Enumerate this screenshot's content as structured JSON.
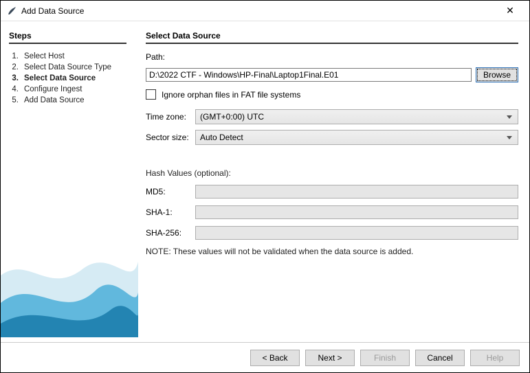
{
  "window": {
    "title": "Add Data Source"
  },
  "sidebar": {
    "heading": "Steps",
    "steps": [
      {
        "num": "1.",
        "label": "Select Host"
      },
      {
        "num": "2.",
        "label": "Select Data Source Type"
      },
      {
        "num": "3.",
        "label": "Select Data Source",
        "current": true
      },
      {
        "num": "4.",
        "label": "Configure Ingest"
      },
      {
        "num": "5.",
        "label": "Add Data Source"
      }
    ]
  },
  "content": {
    "heading": "Select Data Source",
    "path_label": "Path:",
    "path_value": "D:\\2022 CTF - Windows\\HP-Final\\Laptop1Final.E01",
    "browse_label": "Browse",
    "orphan_label": "Ignore orphan files in FAT file systems",
    "orphan_checked": false,
    "timezone_label": "Time zone:",
    "timezone_value": "(GMT+0:00) UTC",
    "sector_label": "Sector size:",
    "sector_value": "Auto Detect",
    "hash_heading": "Hash Values (optional):",
    "md5_label": "MD5:",
    "md5_value": "",
    "sha1_label": "SHA-1:",
    "sha1_value": "",
    "sha256_label": "SHA-256:",
    "sha256_value": "",
    "note": "NOTE: These values will not be validated when the data source is added."
  },
  "footer": {
    "back": "< Back",
    "next": "Next >",
    "finish": "Finish",
    "cancel": "Cancel",
    "help": "Help"
  }
}
